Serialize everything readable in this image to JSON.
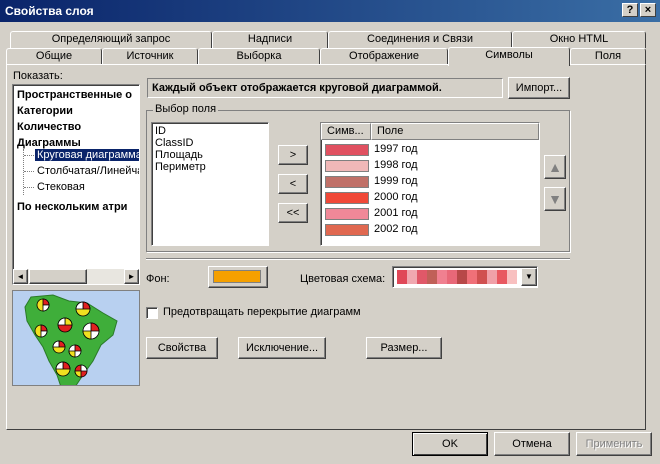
{
  "window": {
    "title": "Свойства слоя",
    "help_glyph": "?",
    "close_glyph": "×"
  },
  "tabs": {
    "row1": [
      {
        "label": "Определяющий запрос"
      },
      {
        "label": "Надписи"
      },
      {
        "label": "Соединения и Связи"
      },
      {
        "label": "Окно HTML"
      }
    ],
    "row2": [
      {
        "label": "Общие"
      },
      {
        "label": "Источник"
      },
      {
        "label": "Выборка"
      },
      {
        "label": "Отображение"
      },
      {
        "label": "Символы",
        "active": true
      },
      {
        "label": "Поля"
      }
    ]
  },
  "show_label": "Показать:",
  "tree": [
    {
      "label": "Пространственные о",
      "bold": true
    },
    {
      "label": "Категории",
      "bold": true
    },
    {
      "label": "Количество",
      "bold": true
    },
    {
      "label": "Диаграммы",
      "bold": true
    },
    {
      "label": "Круговая диаграмма",
      "selected": true
    },
    {
      "label": "Столбчатая/Линейча"
    },
    {
      "label": "Стековая"
    },
    {
      "label": "По нескольким атри",
      "bold": true
    }
  ],
  "description": "Каждый объект отображается круговой диаграммой.",
  "import_button": "Импорт...",
  "field_group_title": "Выбор поля",
  "available_fields": [
    "ID",
    "ClassID",
    "Площадь",
    "Периметр"
  ],
  "move_buttons": {
    "add": ">",
    "remove": "<",
    "remove_all": "<<"
  },
  "selected_fields": {
    "header_symbol": "Симв...",
    "header_field": "Поле",
    "rows": [
      {
        "label": "1997 год",
        "color": "#e05060"
      },
      {
        "label": "1998 год",
        "color": "#f0b8b8"
      },
      {
        "label": "1999 год",
        "color": "#c07068"
      },
      {
        "label": "2000 год",
        "color": "#f04838"
      },
      {
        "label": "2001 год",
        "color": "#f08898"
      },
      {
        "label": "2002 год",
        "color": "#e06850"
      }
    ]
  },
  "up_arrow": "▲",
  "down_arrow": "▼",
  "background_label": "Фон:",
  "background_color": "#f5a000",
  "color_scheme_label": "Цветовая схема:",
  "color_scheme": [
    "#e04858",
    "#f0a8b0",
    "#e05868",
    "#c06058",
    "#f08090",
    "#e86878",
    "#b84848",
    "#f07078",
    "#d05050",
    "#f0a0a8",
    "#e85860",
    "#f8c0c0"
  ],
  "dropdown_arrow": "▼",
  "prevent_overlap_label": "Предотвращать перекрытие диаграмм",
  "properties_button": "Свойства",
  "exclusion_button": "Исключение...",
  "size_button": "Размер...",
  "ok_button": "OK",
  "cancel_button": "Отмена",
  "apply_button": "Применить",
  "hscroll": {
    "left": "◄",
    "right": "►"
  }
}
